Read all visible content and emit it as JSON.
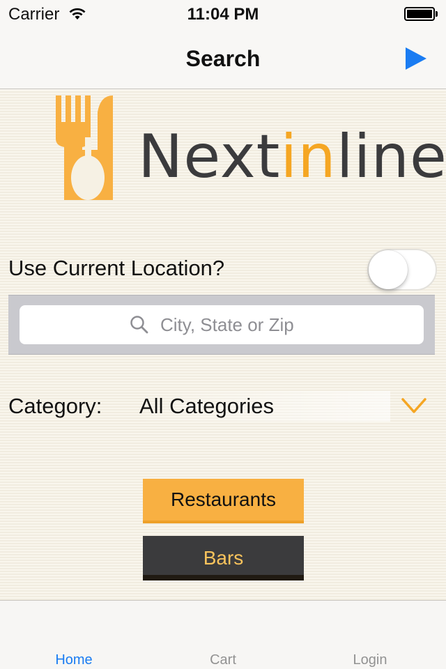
{
  "status_bar": {
    "carrier": "Carrier",
    "time": "11:04 PM"
  },
  "nav": {
    "title": "Search",
    "play_icon": "play-icon",
    "accent_color": "#1a7cf2"
  },
  "logo": {
    "text_before": "Next",
    "text_accent": "in",
    "text_after": "line",
    "icon": "fork-spoon-icon",
    "brand_orange": "#f8b042",
    "brand_dark": "#3b3b3d"
  },
  "location": {
    "label": "Use Current Location?",
    "toggle_on": false
  },
  "search": {
    "placeholder": "City, State or Zip",
    "value": ""
  },
  "category": {
    "label": "Category:",
    "selected": "All Categories"
  },
  "buttons": {
    "restaurants": "Restaurants",
    "bars": "Bars"
  },
  "tabs": [
    {
      "label": "Home",
      "active": true
    },
    {
      "label": "Cart",
      "active": false
    },
    {
      "label": "Login",
      "active": false
    }
  ]
}
